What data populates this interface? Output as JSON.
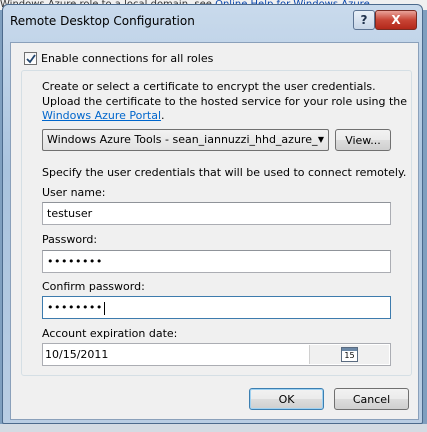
{
  "background": {
    "top_text": "Windows Azure role to a local domain, see ",
    "top_link": "Online Help for Windows Azure"
  },
  "dialog": {
    "title": "Remote Desktop Configuration",
    "help_glyph": "?",
    "close_glyph": "X"
  },
  "enable": {
    "checked": true,
    "label": "Enable connections for all roles"
  },
  "certificate": {
    "intro_line1": "Create or select a certificate to encrypt the user credentials.",
    "intro_line2": "Upload the certificate to the hosted service for your role using the",
    "portal_link": "Windows Azure Portal",
    "portal_link_suffix": ".",
    "selected": "Windows Azure Tools - sean_iannuzzi_hhd_azure_",
    "view_button": "View..."
  },
  "credentials": {
    "intro": "Specify the user credentials that will be used to connect remotely.",
    "username_label": "User name:",
    "username_value": "testuser",
    "password_label": "Password:",
    "password_value": "••••••••",
    "confirm_label": "Confirm password:",
    "confirm_value": "••••••••",
    "expiration_label": "Account expiration date:",
    "expiration_value": "10/15/2011",
    "calendar_day": "15"
  },
  "buttons": {
    "ok": "OK",
    "cancel": "Cancel"
  },
  "colors": {
    "link": "#0066cc",
    "close_button": "#c84535"
  }
}
